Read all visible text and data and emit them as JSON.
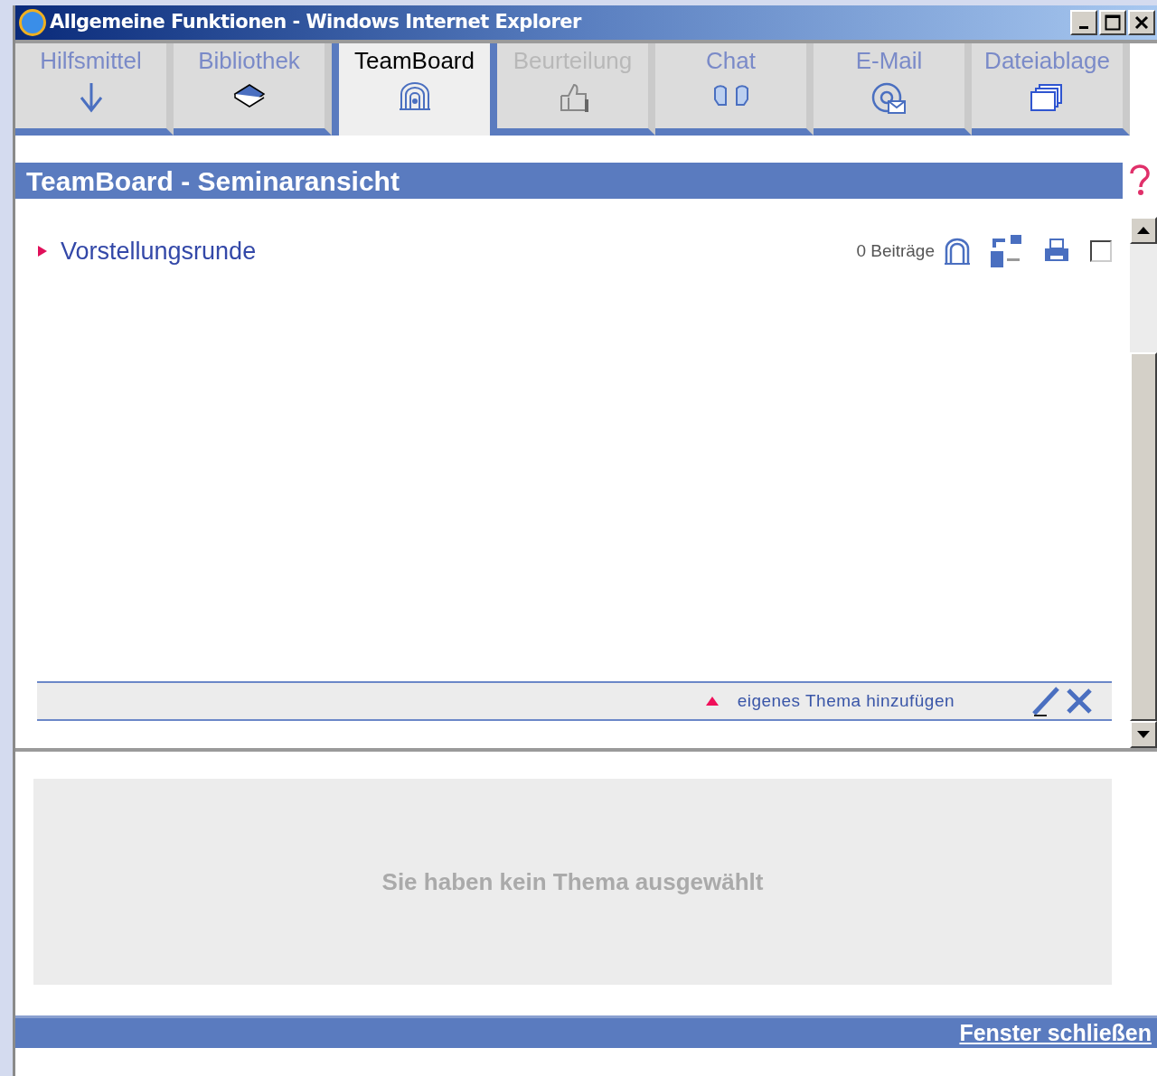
{
  "window": {
    "title": "Allgemeine Funktionen - Windows Internet Explorer"
  },
  "tabs": [
    {
      "label": "Hilfsmittel",
      "selected": false,
      "disabled": false
    },
    {
      "label": "Bibliothek",
      "selected": false,
      "disabled": false
    },
    {
      "label": "TeamBoard",
      "selected": true,
      "disabled": false
    },
    {
      "label": "Beurteilung",
      "selected": false,
      "disabled": true
    },
    {
      "label": "Chat",
      "selected": false,
      "disabled": false
    },
    {
      "label": "E-Mail",
      "selected": false,
      "disabled": false
    },
    {
      "label": "Dateiablage",
      "selected": false,
      "disabled": false
    }
  ],
  "header": {
    "title": "TeamBoard - Seminaransicht"
  },
  "topics": [
    {
      "title": "Vorstellungsrunde",
      "count": "0 Beiträge",
      "checked": false
    }
  ],
  "add_topic": {
    "label": "eigenes Thema hinzufügen"
  },
  "detail": {
    "message": "Sie haben kein Thema ausgewählt"
  },
  "footer": {
    "link": "Fenster schließen"
  }
}
